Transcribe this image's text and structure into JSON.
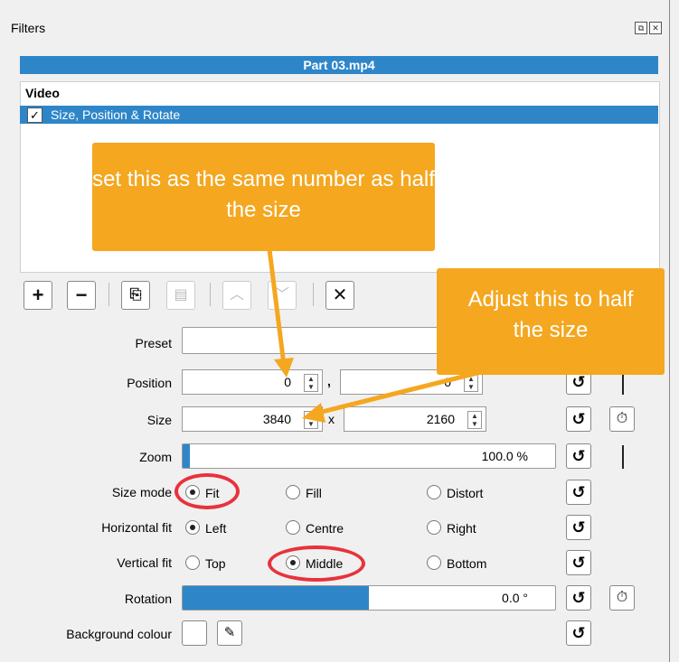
{
  "panel": {
    "title": "Filters",
    "restore_icon": "restore-icon",
    "close_icon": "close-icon"
  },
  "clip": {
    "name": "Part 03.mp4"
  },
  "filters": {
    "category": "Video",
    "items": [
      {
        "label": "Size, Position & Rotate",
        "checked": true,
        "selected": true
      }
    ]
  },
  "toolbar": {
    "add_icon": "plus-icon",
    "remove_icon": "minus-icon",
    "copy_icon": "copy-icon",
    "paste_icon": "paste-icon",
    "up_icon": "chevron-up-icon",
    "down_icon": "chevron-down-icon",
    "deselect_icon": "close-icon"
  },
  "form": {
    "preset_label": "Preset",
    "preset_value": "",
    "position_label": "Position",
    "position_x": "0",
    "position_sep": ",",
    "position_y": "0",
    "size_label": "Size",
    "size_w": "3840",
    "size_sep": "x",
    "size_h": "2160",
    "zoom_label": "Zoom",
    "zoom_value": "100.0 %",
    "zoom_level": 0.02,
    "size_mode_label": "Size mode",
    "size_mode_options": [
      "Fit",
      "Fill",
      "Distort"
    ],
    "size_mode_selected": "Fit",
    "hfit_label": "Horizontal fit",
    "hfit_options": [
      "Left",
      "Centre",
      "Right"
    ],
    "hfit_selected": "Left",
    "vfit_label": "Vertical fit",
    "vfit_options": [
      "Top",
      "Middle",
      "Bottom"
    ],
    "vfit_selected": "Middle",
    "rotation_label": "Rotation",
    "rotation_value": "0.0 °",
    "rotation_level": 0.5,
    "bg_label": "Background colour",
    "bg_colour": "#ffffff"
  },
  "annotations": {
    "callout_position": "set this as the same number as half the size",
    "callout_size": "Adjust this to half the size",
    "callout_color": "#f4a71f",
    "highlight_color": "#e8323c"
  },
  "colors": {
    "accent": "#2e86c9"
  }
}
